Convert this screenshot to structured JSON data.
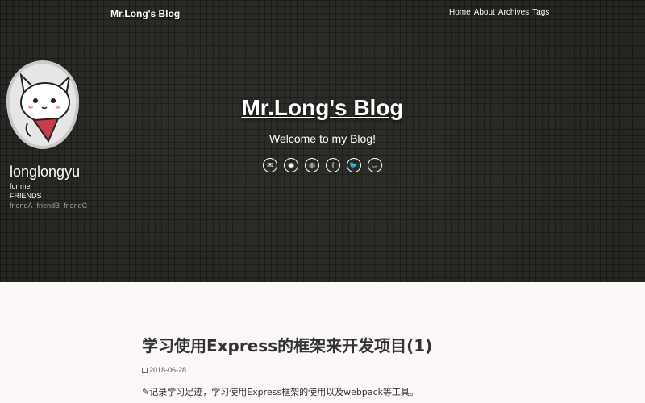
{
  "nav": {
    "brand": "Mr.Long's Blog",
    "links": [
      "Home",
      "About",
      "Archives",
      "Tags"
    ]
  },
  "profile": {
    "username": "longlongyu",
    "tagline": "for me",
    "friends_title": "FRIENDS",
    "friends": [
      "friendA",
      "friendB",
      "friendC"
    ]
  },
  "hero": {
    "title": "Mr.Long's Blog",
    "subtitle": "Welcome to my Blog!",
    "social_icons": [
      {
        "icon": "envelope-icon",
        "glyph": "✉"
      },
      {
        "icon": "github-icon",
        "glyph": "◉"
      },
      {
        "icon": "weibo-icon",
        "glyph": "◍"
      },
      {
        "icon": "facebook-icon",
        "glyph": "f"
      },
      {
        "icon": "twitter-icon",
        "glyph": "🐦"
      },
      {
        "icon": "rss-icon",
        "glyph": "⊃"
      }
    ]
  },
  "post": {
    "title": "学习使用Express的框架来开发项目(1)",
    "date": "2018-06-28",
    "excerpt": "✎记录学习足迹，学习使用Express框架的使用以及webpack等工具。"
  },
  "colors": {
    "banner_bg": "#242521",
    "page_bg": "#fbf8f7",
    "friend_link": "#9aa0a3"
  }
}
